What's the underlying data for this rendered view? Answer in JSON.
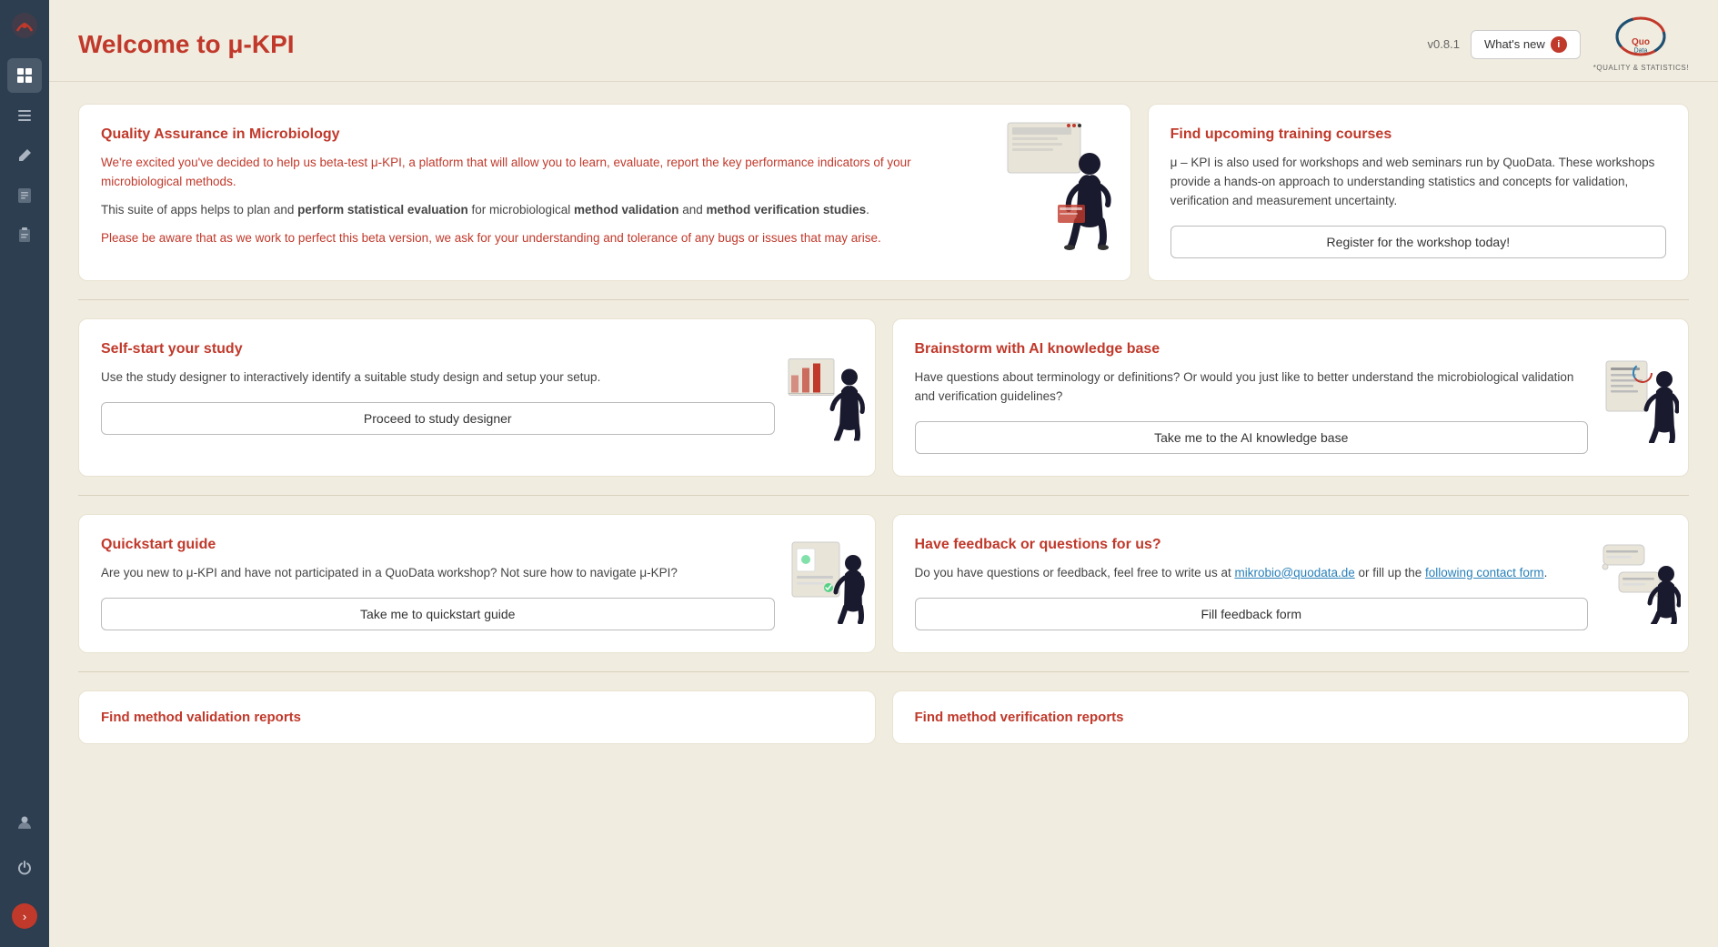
{
  "app": {
    "title": "Welcome to μ-KPI",
    "version": "v0.8.1"
  },
  "header": {
    "whats_new_label": "What's new",
    "whats_new_badge": "i",
    "quodata_label": "*QUALITY & STATISTICS!"
  },
  "sidebar": {
    "items": [
      {
        "id": "logo",
        "icon": "⚙",
        "label": "logo"
      },
      {
        "id": "dashboard",
        "icon": "▦",
        "label": "dashboard"
      },
      {
        "id": "reports",
        "icon": "≡",
        "label": "reports"
      },
      {
        "id": "pen",
        "icon": "✎",
        "label": "edit"
      },
      {
        "id": "table",
        "icon": "▤",
        "label": "table"
      },
      {
        "id": "clipboard",
        "icon": "📋",
        "label": "clipboard"
      }
    ],
    "bottom": [
      {
        "id": "user",
        "icon": "👤",
        "label": "user"
      },
      {
        "id": "power",
        "icon": "⏻",
        "label": "power"
      }
    ],
    "expand_icon": "›"
  },
  "cards": {
    "intro": {
      "title": "Quality Assurance in Microbiology",
      "text1": "We're excited you've decided to help us beta-test μ-KPI, a platform that will allow you to learn, evaluate, report the key performance indicators of your microbiological methods.",
      "text2": "This suite of apps helps to plan and perform statistical evaluation for microbiological method validation and method verification studies.",
      "text3": "Please be aware that as we work to perfect this beta version, we ask for your understanding and tolerance of any bugs or issues that may arise."
    },
    "training": {
      "title": "Find upcoming training courses",
      "text": "μ – KPI is also used for workshops and web seminars run by QuoData. These workshops provide a hands-on approach to understanding statistics and concepts for validation, verification and measurement uncertainty.",
      "btn_label": "Register for the workshop today!"
    },
    "study": {
      "title": "Self-start your study",
      "text": "Use the study designer to interactively identify a suitable study design and setup your setup.",
      "btn_label": "Proceed to study designer"
    },
    "ai": {
      "title": "Brainstorm with AI knowledge base",
      "text": "Have questions about terminology or definitions? Or would you just like to better understand the microbiological validation and verification guidelines?",
      "btn_label": "Take me to the AI knowledge base"
    },
    "quickstart": {
      "title": "Quickstart guide",
      "text": "Are you new to μ-KPI and have not participated in a QuoData workshop? Not sure how to navigate μ-KPI?",
      "btn_label": "Take me to quickstart guide"
    },
    "feedback": {
      "title": "Have feedback or questions for us?",
      "text1": "Do you have questions or feedback, feel free to write us at",
      "email": "mikrobio@quodata.de",
      "text2": "or fill up the",
      "link": "following contact form",
      "text3": ".",
      "btn_label": "Fill feedback form"
    },
    "validation": {
      "title": "Find method validation reports"
    },
    "verification": {
      "title": "Find method verification reports"
    }
  }
}
